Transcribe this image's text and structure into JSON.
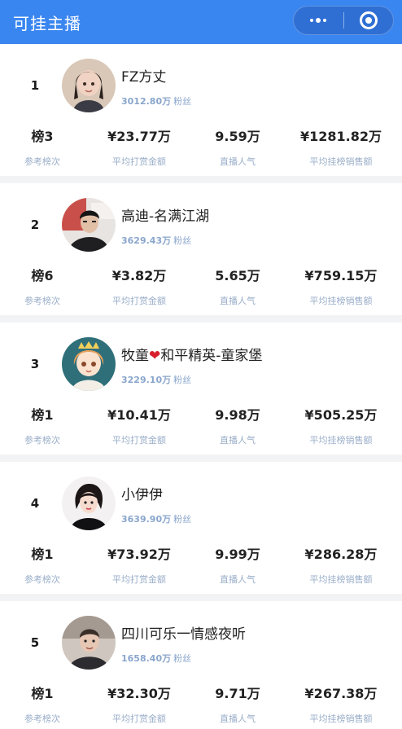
{
  "nav": {
    "title": "可挂主播",
    "more_icon": "more-dots-icon",
    "close_icon": "target-circle-icon"
  },
  "anchors": [
    {
      "rank": "1",
      "name": "FZ方丈",
      "fans_value": "3012.80万",
      "fans_unit": "粉丝",
      "ref_rank": "榜3",
      "avg_reward": "¥23.77万",
      "popularity": "9.59万",
      "avg_sales": "¥1281.82万"
    },
    {
      "rank": "2",
      "name": "高迪-名满江湖",
      "fans_value": "3629.43万",
      "fans_unit": "粉丝",
      "ref_rank": "榜6",
      "avg_reward": "¥3.82万",
      "popularity": "5.65万",
      "avg_sales": "¥759.15万"
    },
    {
      "rank": "3",
      "name_before": "牧童",
      "name_heart": "❤",
      "name_after": "和平精英-童家堡",
      "fans_value": "3229.10万",
      "fans_unit": "粉丝",
      "ref_rank": "榜1",
      "avg_reward": "¥10.41万",
      "popularity": "9.98万",
      "avg_sales": "¥505.25万"
    },
    {
      "rank": "4",
      "name": "小伊伊",
      "fans_value": "3639.90万",
      "fans_unit": "粉丝",
      "ref_rank": "榜1",
      "avg_reward": "¥73.92万",
      "popularity": "9.99万",
      "avg_sales": "¥286.28万"
    },
    {
      "rank": "5",
      "name": "四川可乐一情感夜听",
      "fans_value": "1658.40万",
      "fans_unit": "粉丝",
      "ref_rank": "榜1",
      "avg_reward": "¥32.30万",
      "popularity": "9.71万",
      "avg_sales": "¥267.38万"
    }
  ],
  "labels": {
    "ref_rank": "参考榜次",
    "avg_reward": "平均打赏金额",
    "popularity": "直播人气",
    "avg_sales": "平均挂榜销售额"
  },
  "colors": {
    "nav_bg": "#3a86f0",
    "label": "#9aaec9",
    "fans": "#8aa6cc",
    "heart": "#d81e2a"
  }
}
